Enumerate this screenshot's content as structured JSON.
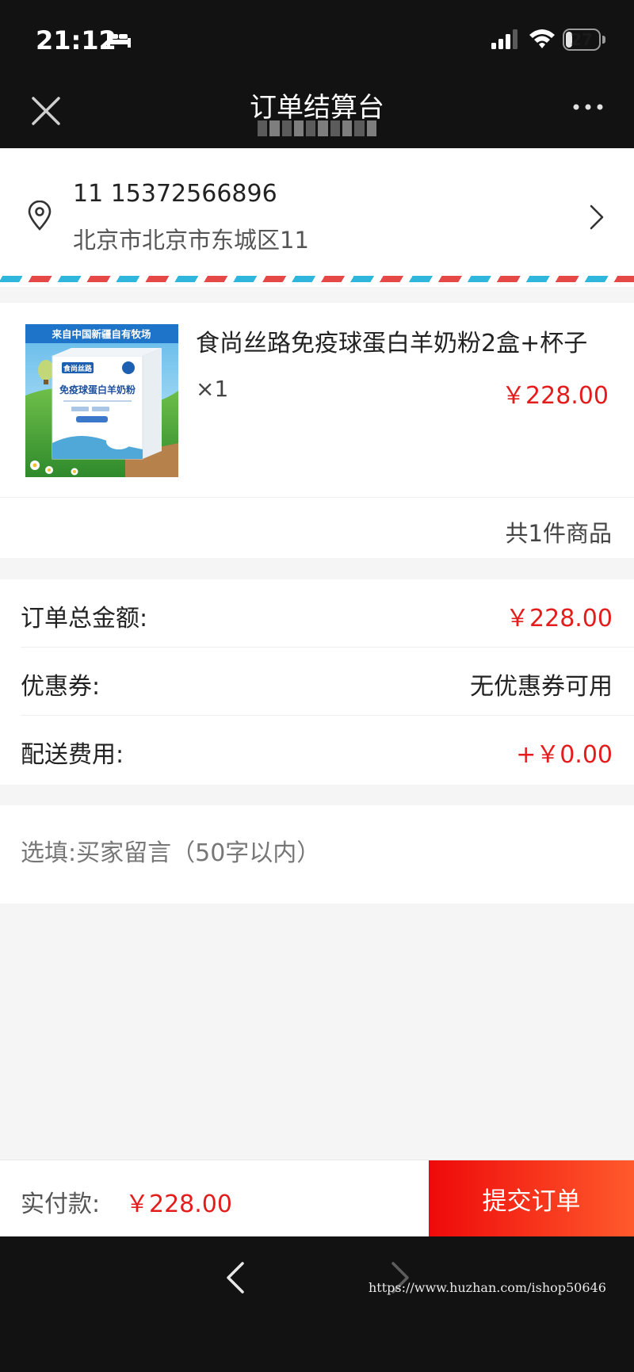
{
  "status_bar": {
    "time": "21:12",
    "battery": "27",
    "battery_level": 0.27
  },
  "nav": {
    "title": "订单结算台"
  },
  "address": {
    "name_phone": "11 15372566896",
    "detail": "北京市北京市东城区11"
  },
  "product": {
    "image_banner": "来自中国新疆自有牧场",
    "image_brand": "食尚丝路",
    "image_product": "免疫球蛋白羊奶粉",
    "title": "食尚丝路免疫球蛋白羊奶粉2盒+杯子",
    "quantity": "×1",
    "price": "￥228.00",
    "count": "共1件商品"
  },
  "summary": {
    "total_label": "订单总金额:",
    "total_value": "￥228.00",
    "coupon_label": "优惠券:",
    "coupon_value": "无优惠券可用",
    "shipping_label": "配送费用:",
    "shipping_value": "+￥0.00"
  },
  "message": {
    "placeholder": "选填:买家留言（50字以内）"
  },
  "bottom": {
    "pay_label": "实付款:",
    "pay_amount": "￥228.00",
    "submit_label": "提交订单"
  },
  "watermark": "https://www.huzhan.com/ishop50646",
  "colors": {
    "price_red": "#e51c1c",
    "submit_start": "#ee0a0a",
    "submit_end": "#ff5a2c",
    "bar_dark": "#121212"
  },
  "icons": [
    "bed-icon",
    "cellular-signal-icon",
    "wifi-icon",
    "battery-icon",
    "close-icon",
    "more-icon",
    "location-pin-icon",
    "chevron-right-icon",
    "back-arrow-icon",
    "forward-arrow-icon"
  ]
}
